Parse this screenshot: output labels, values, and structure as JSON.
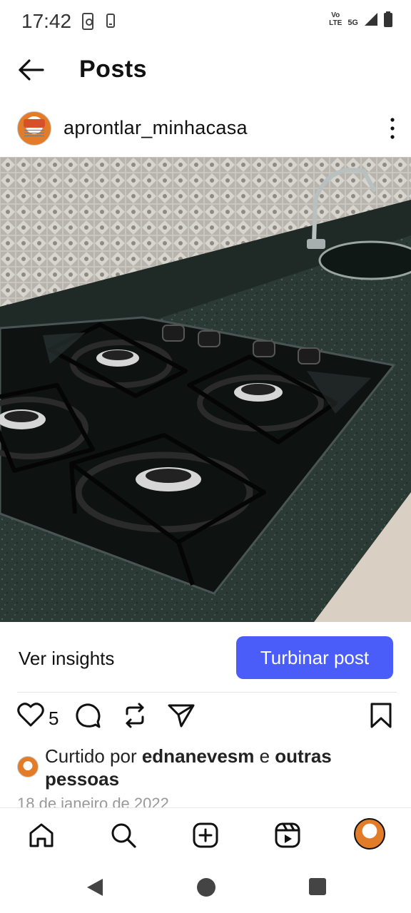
{
  "status_bar": {
    "time": "17:42",
    "net_top": "Vo",
    "net_mid": "LTE",
    "network": "5G"
  },
  "header": {
    "title": "Posts"
  },
  "post": {
    "username": "aprontlar_minhacasa",
    "insights_label": "Ver insights",
    "boost_label": "Turbinar post",
    "like_count": "5",
    "liked_by_prefix": "Curtido por ",
    "liked_by_user": "ednanevesm",
    "liked_by_middle": " e ",
    "liked_by_others": "outras pessoas",
    "date": "18 de janeiro de 2022"
  },
  "colors": {
    "accent": "#4a5df9",
    "text": "#111111",
    "muted": "#999999"
  },
  "icons": {
    "back": "arrow-left-icon",
    "more": "more-vertical-icon",
    "like": "heart-icon",
    "comment": "comment-icon",
    "repost": "repost-icon",
    "share": "send-icon",
    "save": "bookmark-icon",
    "home": "home-icon",
    "search": "search-icon",
    "create": "plus-square-icon",
    "reels": "reels-icon"
  }
}
